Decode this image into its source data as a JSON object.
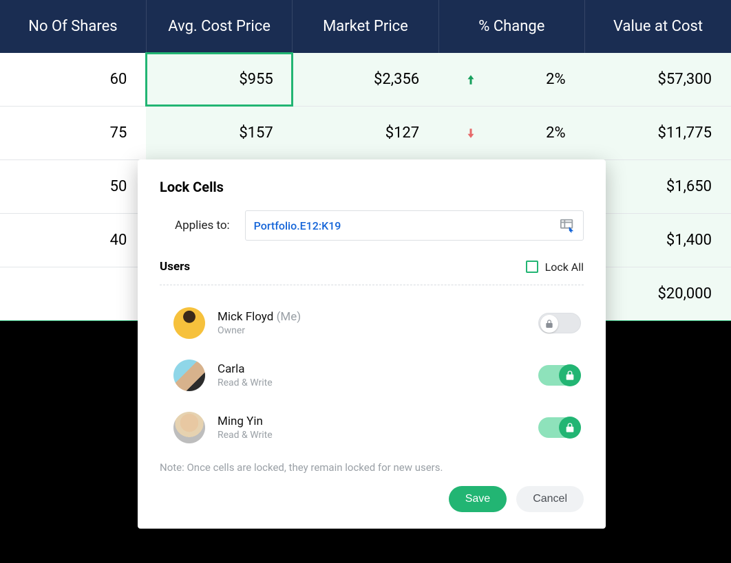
{
  "table": {
    "headers": [
      "No Of Shares",
      "Avg. Cost Price",
      "Market Price",
      "% Change",
      "Value at Cost"
    ],
    "rows": [
      {
        "shares": "60",
        "avg_cost": "$955",
        "market": "$2,356",
        "dir": "up",
        "change": "2%",
        "value": "$57,300"
      },
      {
        "shares": "75",
        "avg_cost": "$157",
        "market": "$127",
        "dir": "down",
        "change": "2%",
        "value": "$11,775"
      },
      {
        "shares": "50",
        "avg_cost": "",
        "market": "",
        "dir": "",
        "change": "",
        "value": "$1,650"
      },
      {
        "shares": "40",
        "avg_cost": "",
        "market": "",
        "dir": "",
        "change": "",
        "value": "$1,400"
      },
      {
        "shares": "",
        "avg_cost": "",
        "market": "",
        "dir": "",
        "change": "",
        "value": "$20,000"
      }
    ]
  },
  "dialog": {
    "title": "Lock Cells",
    "applies_label": "Applies to:",
    "range": "Portfolio.E12:K19",
    "users_title": "Users",
    "lock_all_label": "Lock All",
    "users": [
      {
        "name": "Mick Floyd",
        "me": "(Me)",
        "role": "Owner",
        "locked": false
      },
      {
        "name": "Carla",
        "me": "",
        "role": "Read & Write",
        "locked": true
      },
      {
        "name": "Ming Yin",
        "me": "",
        "role": "Read & Write",
        "locked": true
      }
    ],
    "note": "Note: Once cells are locked, they remain locked for new users.",
    "save_label": "Save",
    "cancel_label": "Cancel"
  }
}
